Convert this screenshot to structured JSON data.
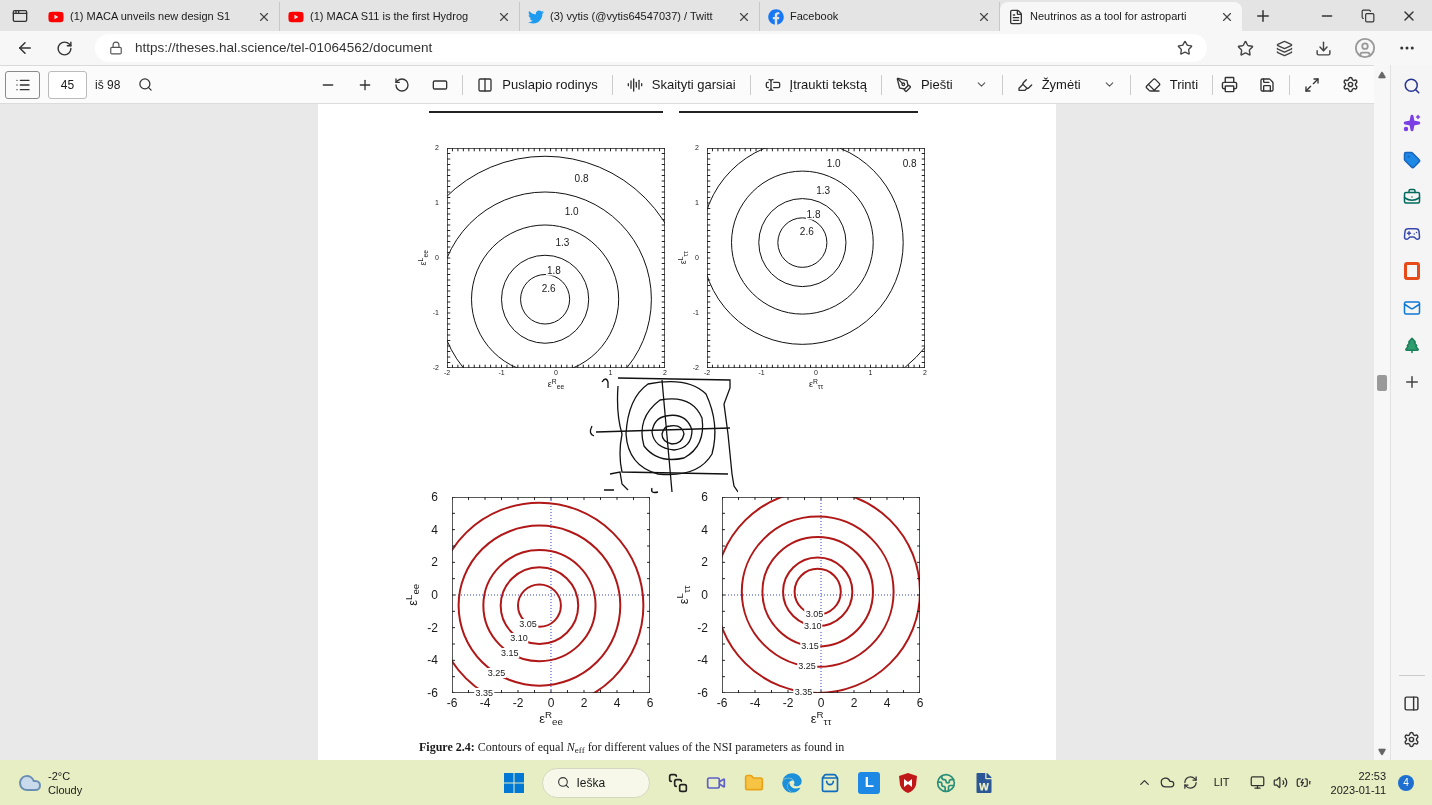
{
  "tabs": [
    {
      "title": "(1) MACA unveils new design S1",
      "kind": "youtube",
      "selected": false
    },
    {
      "title": "(1) MACA S11 is the first Hydrog",
      "kind": "youtube",
      "selected": false
    },
    {
      "title": "(3) vytis (@vytis64547037) / Twitt",
      "kind": "twitter",
      "selected": false
    },
    {
      "title": "Facebook",
      "kind": "facebook",
      "selected": false
    },
    {
      "title": "Neutrinos as a tool for astroparti",
      "kind": "document",
      "selected": true
    }
  ],
  "address_bar": {
    "url": "https://theses.hal.science/tel-01064562/document"
  },
  "pdf_toolbar": {
    "page": "45",
    "total": "iš 98",
    "buttons": [
      {
        "label": "Puslapio rodinys",
        "kind": "page-view",
        "dropdown": false
      },
      {
        "label": "Skaityti garsiai",
        "kind": "read-aloud",
        "dropdown": false
      },
      {
        "label": "Įtraukti tekstą",
        "kind": "add-text",
        "dropdown": false
      },
      {
        "label": "Piešti",
        "kind": "draw",
        "dropdown": true
      },
      {
        "label": "Žymėti",
        "kind": "highlight",
        "dropdown": true
      },
      {
        "label": "Trinti",
        "kind": "erase",
        "dropdown": false
      }
    ]
  },
  "figure": {
    "plots": [
      {
        "ylabel": "ε$^{L}$$_{ee}$",
        "xlabel": "ε$^{R}$$_{ee}$",
        "xticks": [
          "-2",
          "-1",
          "0",
          "1",
          "2"
        ],
        "yticks": [
          "2",
          "1",
          "0",
          "-1",
          "-2"
        ],
        "contours": [
          "2.6",
          "1.8",
          "1.3",
          "1.0",
          "0.8"
        ]
      },
      {
        "ylabel": "ε$^{L}$$_{ττ}$",
        "xlabel": "ε$^{R}$$_{ττ}$",
        "xticks": [
          "-2",
          "-1",
          "0",
          "1",
          "2"
        ],
        "yticks": [
          "2",
          "1",
          "0",
          "-1",
          "-2"
        ],
        "contours": [
          "2.6",
          "1.8",
          "1.3",
          "1.0",
          "0.8"
        ]
      },
      {
        "ylabel": "ε$^{L}$$_{ee}$",
        "xlabel": "ε$^{R}$$_{ee}$",
        "xticks": [
          "-6",
          "-4",
          "-2",
          "0",
          "2",
          "4",
          "6"
        ],
        "yticks": [
          "6",
          "4",
          "2",
          "0",
          "-2",
          "-4",
          "-6"
        ],
        "contours": [
          "3.05",
          "3.10",
          "3.15",
          "3.25",
          "3.35"
        ]
      },
      {
        "ylabel": "ε$^{L}$$_{ττ}$",
        "xlabel": "ε$^{R}$$_{ττ}$",
        "xticks": [
          "-6",
          "-4",
          "-2",
          "0",
          "2",
          "4",
          "6"
        ],
        "yticks": [
          "6",
          "4",
          "2",
          "0",
          "-2",
          "-4",
          "-6"
        ],
        "contours": [
          "3.05",
          "3.10",
          "3.15",
          "3.25",
          "3.35"
        ]
      }
    ],
    "caption": "**Figure 2.4:** Contours of equal *N*$_{eff}$ for different values of the NSI parameters as found in"
  },
  "taskbar": {
    "weather": {
      "temp": "-2°C",
      "condition": "Cloudy"
    },
    "search": "Ieška",
    "apps": [
      {
        "kind": "task-view"
      },
      {
        "kind": "chat"
      },
      {
        "kind": "folder"
      },
      {
        "kind": "edge"
      },
      {
        "kind": "store"
      },
      {
        "kind": "letter",
        "label": "L"
      },
      {
        "kind": "shield"
      },
      {
        "kind": "globe"
      },
      {
        "kind": "word"
      }
    ],
    "language": "LIT",
    "time": "22:53",
    "date": "2023-01-11",
    "notifications": "4"
  }
}
